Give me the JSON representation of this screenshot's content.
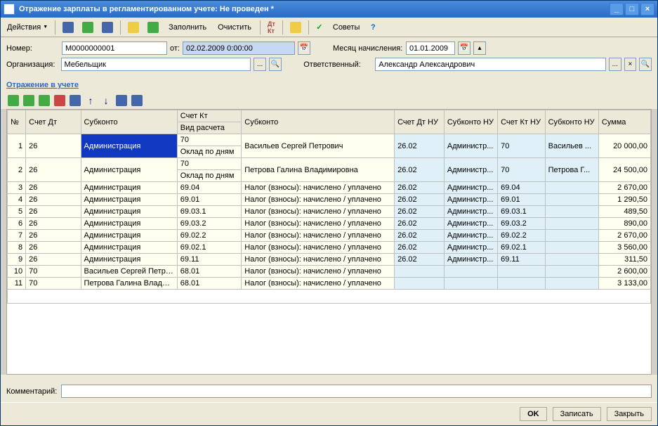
{
  "window": {
    "title": "Отражение зарплаты в регламентированном учете: Не проведен *"
  },
  "toolbar": {
    "actions": "Действия",
    "fill": "Заполнить",
    "clear": "Очистить",
    "tips": "Советы"
  },
  "form": {
    "number_label": "Номер:",
    "number": "М0000000001",
    "from_label": "от:",
    "date": "02.02.2009 0:00:00",
    "month_label": "Месяц начисления:",
    "month": "01.01.2009",
    "org_label": "Организация:",
    "org": "Мебельщик",
    "resp_label": "Ответственный:",
    "resp": "Александр Александрович"
  },
  "section": "Отражение в учете",
  "headers": {
    "n": "№",
    "dt": "Счет Дт",
    "sub": "Субконто",
    "kt": "Счет Кт",
    "vid": "Вид расчета",
    "sub2": "Субконто",
    "dtnu": "Счет Дт НУ",
    "subnu": "Субконто НУ",
    "ktnu": "Счет Кт НУ",
    "subnu2": "Субконто НУ",
    "sum": "Сумма"
  },
  "rows": [
    {
      "n": "1",
      "dt": "26",
      "sub": "Администрация",
      "kt": "70",
      "vid": "Оклад по дням",
      "sub2": "Васильев Сергей Петрович",
      "dtnu": "26.02",
      "subnu": "Администр...",
      "ktnu": "70",
      "subnu2": "Васильев ...",
      "sum": "20 000,00",
      "sel": true
    },
    {
      "n": "2",
      "dt": "26",
      "sub": "Администрация",
      "kt": "70",
      "vid": "Оклад по дням",
      "sub2": "Петрова Галина Владимировна",
      "dtnu": "26.02",
      "subnu": "Администр...",
      "ktnu": "70",
      "subnu2": "Петрова Г...",
      "sum": "24 500,00"
    },
    {
      "n": "3",
      "dt": "26",
      "sub": "Администрация",
      "kt": "69.04",
      "vid": "",
      "sub2": "Налог (взносы): начислено / уплачено",
      "dtnu": "26.02",
      "subnu": "Администр...",
      "ktnu": "69.04",
      "subnu2": "",
      "sum": "2 670,00"
    },
    {
      "n": "4",
      "dt": "26",
      "sub": "Администрация",
      "kt": "69.01",
      "vid": "",
      "sub2": "Налог (взносы): начислено / уплачено",
      "dtnu": "26.02",
      "subnu": "Администр...",
      "ktnu": "69.01",
      "subnu2": "",
      "sum": "1 290,50"
    },
    {
      "n": "5",
      "dt": "26",
      "sub": "Администрация",
      "kt": "69.03.1",
      "vid": "",
      "sub2": "Налог (взносы): начислено / уплачено",
      "dtnu": "26.02",
      "subnu": "Администр...",
      "ktnu": "69.03.1",
      "subnu2": "",
      "sum": "489,50"
    },
    {
      "n": "6",
      "dt": "26",
      "sub": "Администрация",
      "kt": "69.03.2",
      "vid": "",
      "sub2": "Налог (взносы): начислено / уплачено",
      "dtnu": "26.02",
      "subnu": "Администр...",
      "ktnu": "69.03.2",
      "subnu2": "",
      "sum": "890,00"
    },
    {
      "n": "7",
      "dt": "26",
      "sub": "Администрация",
      "kt": "69.02.2",
      "vid": "",
      "sub2": "Налог (взносы): начислено / уплачено",
      "dtnu": "26.02",
      "subnu": "Администр...",
      "ktnu": "69.02.2",
      "subnu2": "",
      "sum": "2 670,00"
    },
    {
      "n": "8",
      "dt": "26",
      "sub": "Администрация",
      "kt": "69.02.1",
      "vid": "",
      "sub2": "Налог (взносы): начислено / уплачено",
      "dtnu": "26.02",
      "subnu": "Администр...",
      "ktnu": "69.02.1",
      "subnu2": "",
      "sum": "3 560,00"
    },
    {
      "n": "9",
      "dt": "26",
      "sub": "Администрация",
      "kt": "69.11",
      "vid": "",
      "sub2": "Налог (взносы): начислено / уплачено",
      "dtnu": "26.02",
      "subnu": "Администр...",
      "ktnu": "69.11",
      "subnu2": "",
      "sum": "311,50"
    },
    {
      "n": "10",
      "dt": "70",
      "sub": "Васильев Сергей Петров...",
      "kt": "68.01",
      "vid": "",
      "sub2": "Налог (взносы): начислено / уплачено",
      "dtnu": "",
      "subnu": "",
      "ktnu": "",
      "subnu2": "",
      "sum": "2 600,00"
    },
    {
      "n": "11",
      "dt": "70",
      "sub": "Петрова Галина Владим...",
      "kt": "68.01",
      "vid": "",
      "sub2": "Налог (взносы): начислено / уплачено",
      "dtnu": "",
      "subnu": "",
      "ktnu": "",
      "subnu2": "",
      "sum": "3 133,00"
    }
  ],
  "footer": {
    "comment_label": "Комментарий:",
    "comment": "",
    "ok": "OK",
    "save": "Записать",
    "close": "Закрыть"
  }
}
